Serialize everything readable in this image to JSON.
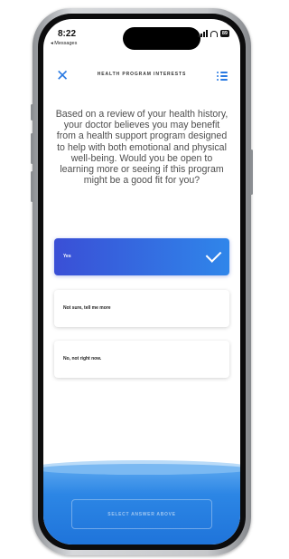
{
  "status_bar": {
    "time": "8:22",
    "back_label": "◂ Messages",
    "battery": "89"
  },
  "header": {
    "title": "HEALTH PROGRAM INTERESTS"
  },
  "question": "Based on a review of your health history, your doctor believes you may benefit from a health support program designed to help with both emotional and physical well-being. Would you be open to learning more or seeing if this program might be a good fit for you?",
  "options": [
    {
      "label": "Yes",
      "selected": true
    },
    {
      "label": "Not sure, tell me more",
      "selected": false
    },
    {
      "label": "No, not right now.",
      "selected": false
    }
  ],
  "footer": {
    "button_label": "SELECT ANSWER ABOVE"
  },
  "colors": {
    "accent": "#2a7ae2",
    "selected_gradient_start": "#3a4fd6",
    "selected_gradient_end": "#2f86ea",
    "footer_blue": "#1f74da"
  },
  "icons": [
    "close-icon",
    "list-icon",
    "checkmark-icon",
    "signal-icon",
    "wifi-icon",
    "battery-icon"
  ]
}
